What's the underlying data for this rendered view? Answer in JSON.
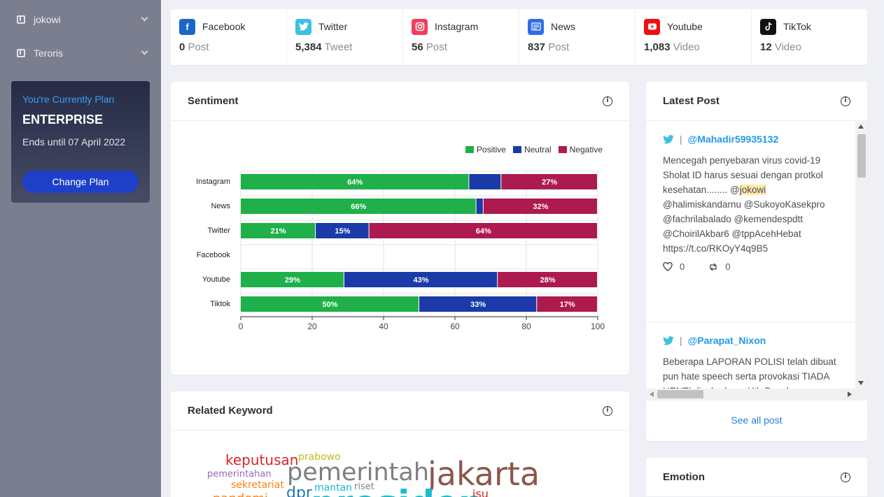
{
  "sidebar": {
    "items": [
      {
        "label": "jokowi"
      },
      {
        "label": "Teroris"
      }
    ],
    "plan": {
      "heading": "You're Currently Plan",
      "name": "ENTERPRISE",
      "ends": "Ends until 07 April 2022",
      "button": "Change Plan"
    }
  },
  "stats": [
    {
      "name": "Facebook",
      "value": "0",
      "unit": "Post",
      "icon": "facebook-icon",
      "color": "#1877f2"
    },
    {
      "name": "Twitter",
      "value": "5,384",
      "unit": "Tweet",
      "icon": "twitter-icon",
      "color": "#3ec1e0"
    },
    {
      "name": "Instagram",
      "value": "56",
      "unit": "Post",
      "icon": "instagram-icon",
      "color": "#f03e5b"
    },
    {
      "name": "News",
      "value": "837",
      "unit": "Post",
      "icon": "news-icon",
      "color": "#2f6de5"
    },
    {
      "name": "Youtube",
      "value": "1,083",
      "unit": "Video",
      "icon": "youtube-icon",
      "color": "#ee1111"
    },
    {
      "name": "TikTok",
      "value": "12",
      "unit": "Video",
      "icon": "tiktok-icon",
      "color": "#111111"
    }
  ],
  "sentiment": {
    "title": "Sentiment"
  },
  "chart_data": {
    "type": "bar",
    "orientation": "horizontal",
    "stacked": true,
    "categories": [
      "Instagram",
      "News",
      "Twitter",
      "Facebook",
      "Youtube",
      "Tiktok"
    ],
    "series": [
      {
        "name": "Positive",
        "color": "#1fb04a",
        "values": [
          64,
          66,
          21,
          0,
          29,
          50
        ]
      },
      {
        "name": "Neutral",
        "color": "#1a3aa8",
        "values": [
          9,
          2,
          15,
          0,
          43,
          33
        ]
      },
      {
        "name": "Negative",
        "color": "#ad1a4f",
        "values": [
          27,
          32,
          64,
          0,
          28,
          17
        ]
      }
    ],
    "xlim": [
      0,
      100
    ],
    "xticks": [
      0,
      20,
      40,
      60,
      80,
      100
    ],
    "legend_position": "top-right",
    "grid": true
  },
  "latest_post": {
    "title": "Latest Post",
    "see_all": "See all post",
    "posts": [
      {
        "user": "@Mahadir59935132",
        "text_before": "Mencegah penyebaran virus covid-19 Sholat ID harus sesuai dengan protkol kesehatan........ @",
        "highlight": "jokowi",
        "text_after": " @halimiskandarnu @SukoyoKasekpro @fachrilabalado @kemendespdtt @ChoirilAkbar6 @tppAcehHebat https://t.co/RKOyY4q9B5",
        "likes": "0",
        "retweets": "0"
      },
      {
        "user": "@Parapat_Nixon",
        "text": "Beberapa LAPORAN POLISI telah dibuat pun hate speech serta provokasi TIADA HENTI disebarkan . Yth Bapak #Kabareskrim @DivHumas_Polri SELAMA KALIAN TIDAK TANGKAP DENNY"
      }
    ]
  },
  "related_keyword": {
    "title": "Related Keyword",
    "words": [
      {
        "text": "keputusan",
        "color": "#d62728"
      },
      {
        "text": "prabowo",
        "color": "#bcbd22"
      },
      {
        "text": "pemerintah",
        "color": "#7f7f7f"
      },
      {
        "text": "jakarta",
        "color": "#8c564b"
      },
      {
        "text": "pemerintahan",
        "color": "#9467bd"
      },
      {
        "text": "sekretariat",
        "color": "#ff7f0e"
      },
      {
        "text": "mantan",
        "color": "#17becf"
      },
      {
        "text": "riset",
        "color": "#7f7f7f"
      },
      {
        "text": "dpr",
        "color": "#1f77b4"
      },
      {
        "text": "presiden",
        "color": "#17becf"
      },
      {
        "text": "isu",
        "color": "#d62728"
      },
      {
        "text": "pandemi",
        "color": "#ff7f0e"
      }
    ]
  },
  "emotion": {
    "title": "Emotion"
  }
}
